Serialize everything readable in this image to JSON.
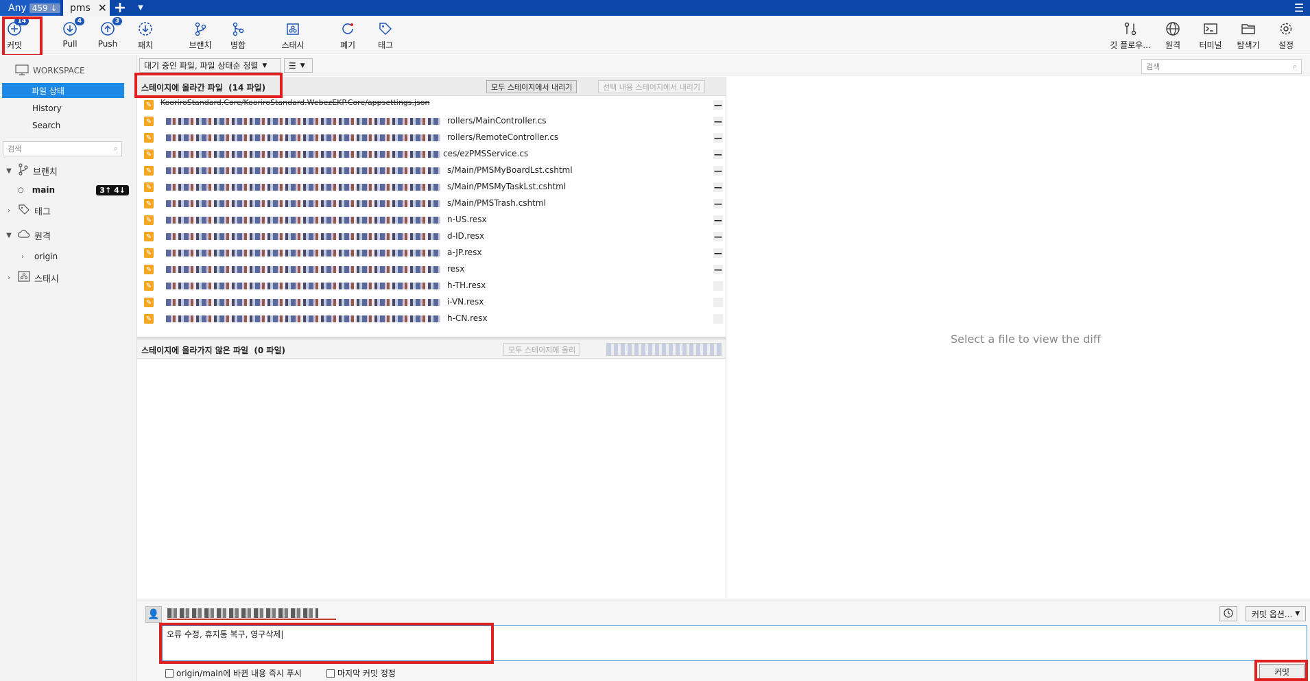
{
  "tabs": {
    "any_label": "Any",
    "any_count": "459",
    "repo_tab": "pms"
  },
  "toolbar": {
    "commit": "커밋",
    "commit_badge": "14",
    "pull": "Pull",
    "pull_badge": "4",
    "push": "Push",
    "push_badge": "3",
    "fetch": "패치",
    "branch": "브랜치",
    "merge": "병합",
    "stash": "스태시",
    "discard": "폐기",
    "tag": "태그",
    "gitflow": "깃 플로우...",
    "remote": "원격",
    "terminal": "터미널",
    "explorer": "탐색기",
    "settings": "설정"
  },
  "sidebar": {
    "workspace": "WORKSPACE",
    "file_status": "파일 상태",
    "history": "History",
    "search": "Search",
    "search_placeholder": "검색",
    "branches": "브랜치",
    "current_branch": "main",
    "branch_status": "3↑ 4↓",
    "tags": "태그",
    "remotes": "원격",
    "origin": "origin",
    "stashes": "스태시"
  },
  "filter": {
    "sort_label": "대기 중인 파일, 파일 상태순 정렬",
    "view_icon": "list-icon",
    "search_placeholder": "검색"
  },
  "staged": {
    "title": "스테이지에 올라간 파일",
    "count": "(14 파일)",
    "unstage_all": "모두 스테이지에서 내리기",
    "unstage_selected": "선택 내용 스테이지에서 내리기",
    "files": [
      "KooriroStandard.Core/KooriroStandard.WebezEKP.Core/appsettings.json",
      "rollers/MainController.cs",
      "rollers/RemoteController.cs",
      "ces/ezPMSService.cs",
      "s/Main/PMSMyBoardLst.cshtml",
      "s/Main/PMSMyTaskLst.cshtml",
      "s/Main/PMSTrash.cshtml",
      "n-US.resx",
      "d-ID.resx",
      "a-JP.resx",
      "resx",
      "h-TH.resx",
      "i-VN.resx",
      "h-CN.resx"
    ]
  },
  "unstaged": {
    "title": "스테이지에 올라가지 않은 파일",
    "count": "(0 파일)",
    "stage_all": "모두 스테이지에 올리"
  },
  "diff": {
    "placeholder": "Select a file to view the diff"
  },
  "commit": {
    "message": "오류 수정, 휴지통 복구, 영구삭제",
    "push_option": "origin/main에 바뀐 내용 즉시 푸시",
    "amend_option": "마지막 커밋 정정",
    "options_button": "커밋 옵션...",
    "commit_button": "커밋"
  },
  "colors": {
    "tabbar": "#0b47a8",
    "selection": "#1e88e5",
    "highlight": "#e02020",
    "modified": "#f5a623"
  }
}
